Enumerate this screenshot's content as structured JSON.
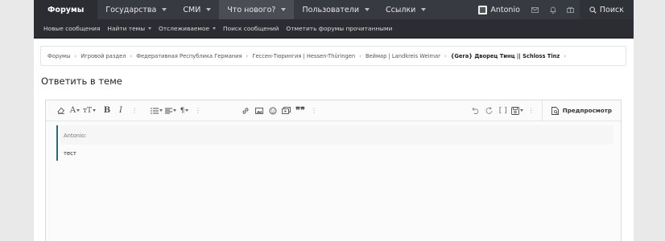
{
  "topnav": {
    "items": [
      {
        "label": "Форумы"
      },
      {
        "label": "Государства"
      },
      {
        "label": "СМИ"
      },
      {
        "label": "Что нового?"
      },
      {
        "label": "Пользователи"
      },
      {
        "label": "Ссылки"
      }
    ],
    "username": "Antonio",
    "search_label": "Поиск",
    "icons": [
      "avatar-icon",
      "envelope-icon",
      "bell-icon",
      "gift-icon",
      "search-icon"
    ]
  },
  "subnav": {
    "items": [
      {
        "label": "Новые сообщения"
      },
      {
        "label": "Найти темы"
      },
      {
        "label": "Отслеживаемое"
      },
      {
        "label": "Поиск сообщений"
      },
      {
        "label": "Отметить форумы прочитанными"
      }
    ]
  },
  "breadcrumb": {
    "items": [
      "Форумы",
      "Игровой раздел",
      "Федеративная Республика Германия",
      "Гессен-Тюрингия | Hessen-Thüringen",
      "Веймар | Landkreis Weimar",
      "{Gera} Дворец Тинц || Schloss Tinz"
    ]
  },
  "page": {
    "title": "Ответить в теме"
  },
  "editor": {
    "preview_label": "Предпросмотр",
    "quote_author": "Antonio:",
    "quote_text": "тест"
  }
}
